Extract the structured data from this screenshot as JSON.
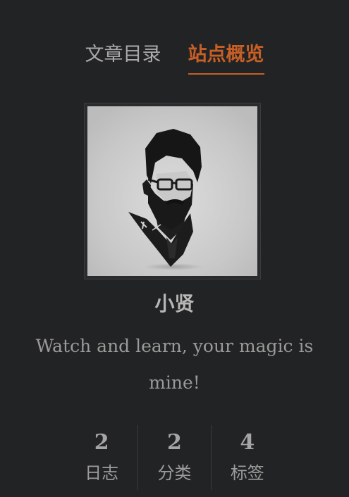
{
  "tabs": [
    {
      "label": "文章目录",
      "active": false
    },
    {
      "label": "站点概览",
      "active": true
    }
  ],
  "author": {
    "name": "小贤",
    "description": "Watch and learn, your magic is mine!"
  },
  "stats": [
    {
      "count": "2",
      "label": "日志"
    },
    {
      "count": "2",
      "label": "分类"
    },
    {
      "count": "4",
      "label": "标签"
    }
  ],
  "colors": {
    "background": "#222324",
    "accent": "#c75f26",
    "text": "#9a9a9a"
  }
}
